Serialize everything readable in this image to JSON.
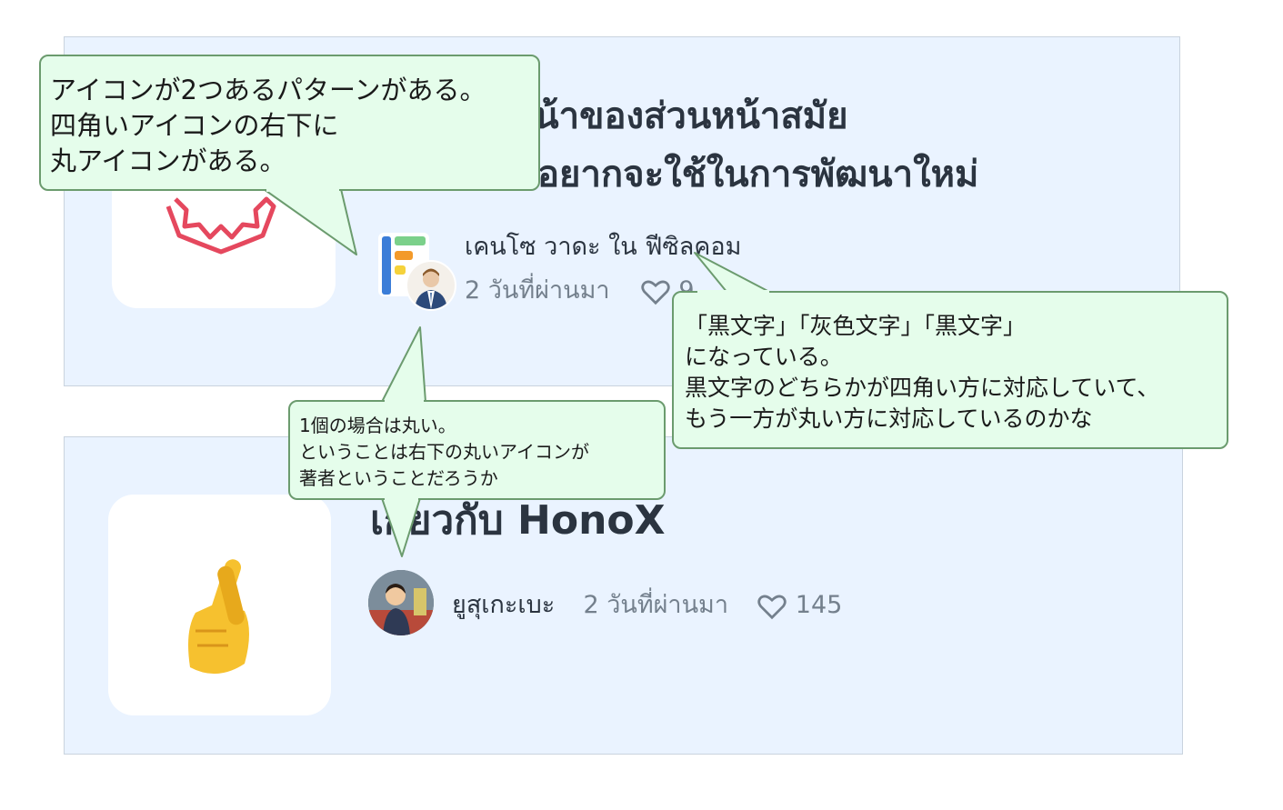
{
  "card1": {
    "title_line1": "024] ส่วนหน้าของส่วนหน้าสมัย",
    "title_line2": "อยากจะใช้ในการพัฒนาใหม่",
    "author_line": "เคนโซ วาดะ ใน ฟีซิลคอม",
    "time": "2 วันที่ผ่านมา",
    "likes": "9"
  },
  "card2": {
    "title": "เกี่ยวกับ HonoX",
    "author": "ยูสุเกะเบะ",
    "time": "2 วันที่ผ่านมา",
    "likes": "145"
  },
  "callouts": {
    "c1": "アイコンが2つあるパターンがある。\n四角いアイコンの右下に\n丸アイコンがある。",
    "c2": "「黒文字」「灰色文字」「黒文字」\nになっている。\n黒文字のどちらかが四角い方に対応していて、\nもう一方が丸い方に対応しているのかな",
    "c3": "1個の場合は丸い。\nということは右下の丸いアイコンが\n著者ということだろうか"
  },
  "icons": {
    "card1_thumb": "red-gear-badge",
    "card2_thumb": "crossed-fingers-emoji",
    "publication_logo": "bar-chart-logo",
    "like": "heart-icon"
  },
  "colors": {
    "card_bg": "#eaf3ff",
    "callout_bg": "#e5fdeb",
    "callout_border": "#6b9b6e",
    "thumb_red": "#e5485e",
    "emoji_yellow": "#f6c12f"
  }
}
